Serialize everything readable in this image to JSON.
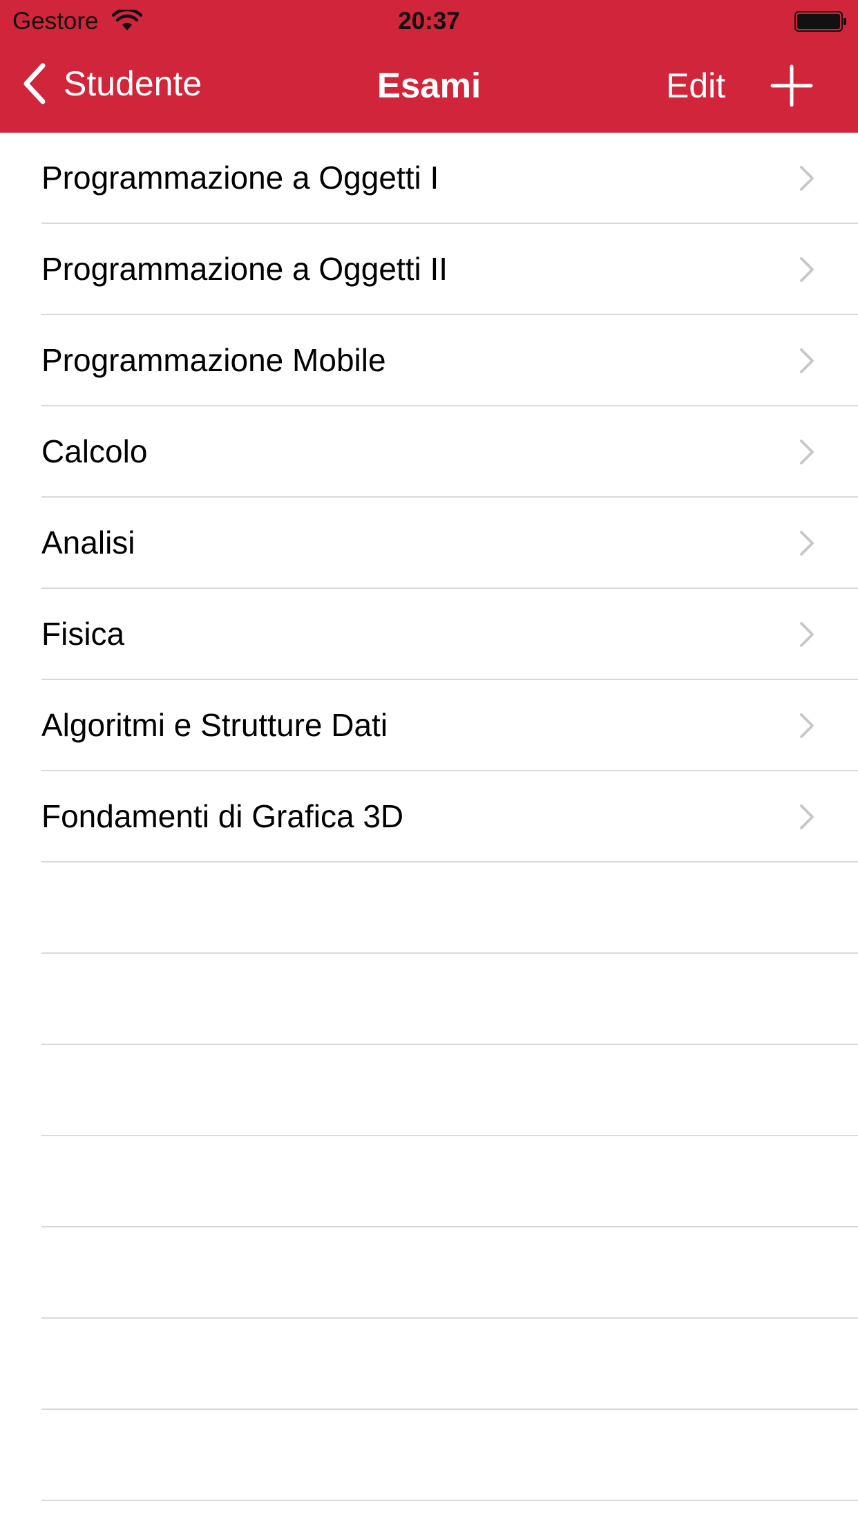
{
  "status_bar": {
    "carrier": "Gestore",
    "time": "20:37",
    "wifi_icon": "wifi-icon",
    "battery_icon": "battery-icon",
    "battery_level": 1.0
  },
  "nav": {
    "back_label": "Studente",
    "title": "Esami",
    "edit_label": "Edit",
    "back_icon": "chevron-left-icon",
    "add_icon": "plus-icon"
  },
  "exams": [
    {
      "label": "Programmazione a Oggetti I"
    },
    {
      "label": "Programmazione a Oggetti II"
    },
    {
      "label": "Programmazione Mobile"
    },
    {
      "label": "Calcolo"
    },
    {
      "label": "Analisi"
    },
    {
      "label": "Fisica"
    },
    {
      "label": "Algoritmi e Strutture Dati"
    },
    {
      "label": "Fondamenti di Grafica 3D"
    }
  ],
  "colors": {
    "nav_background": "#d0253a",
    "nav_text": "#ffffff",
    "separator": "#d9d9dc",
    "chevron": "#c7c7cc"
  }
}
